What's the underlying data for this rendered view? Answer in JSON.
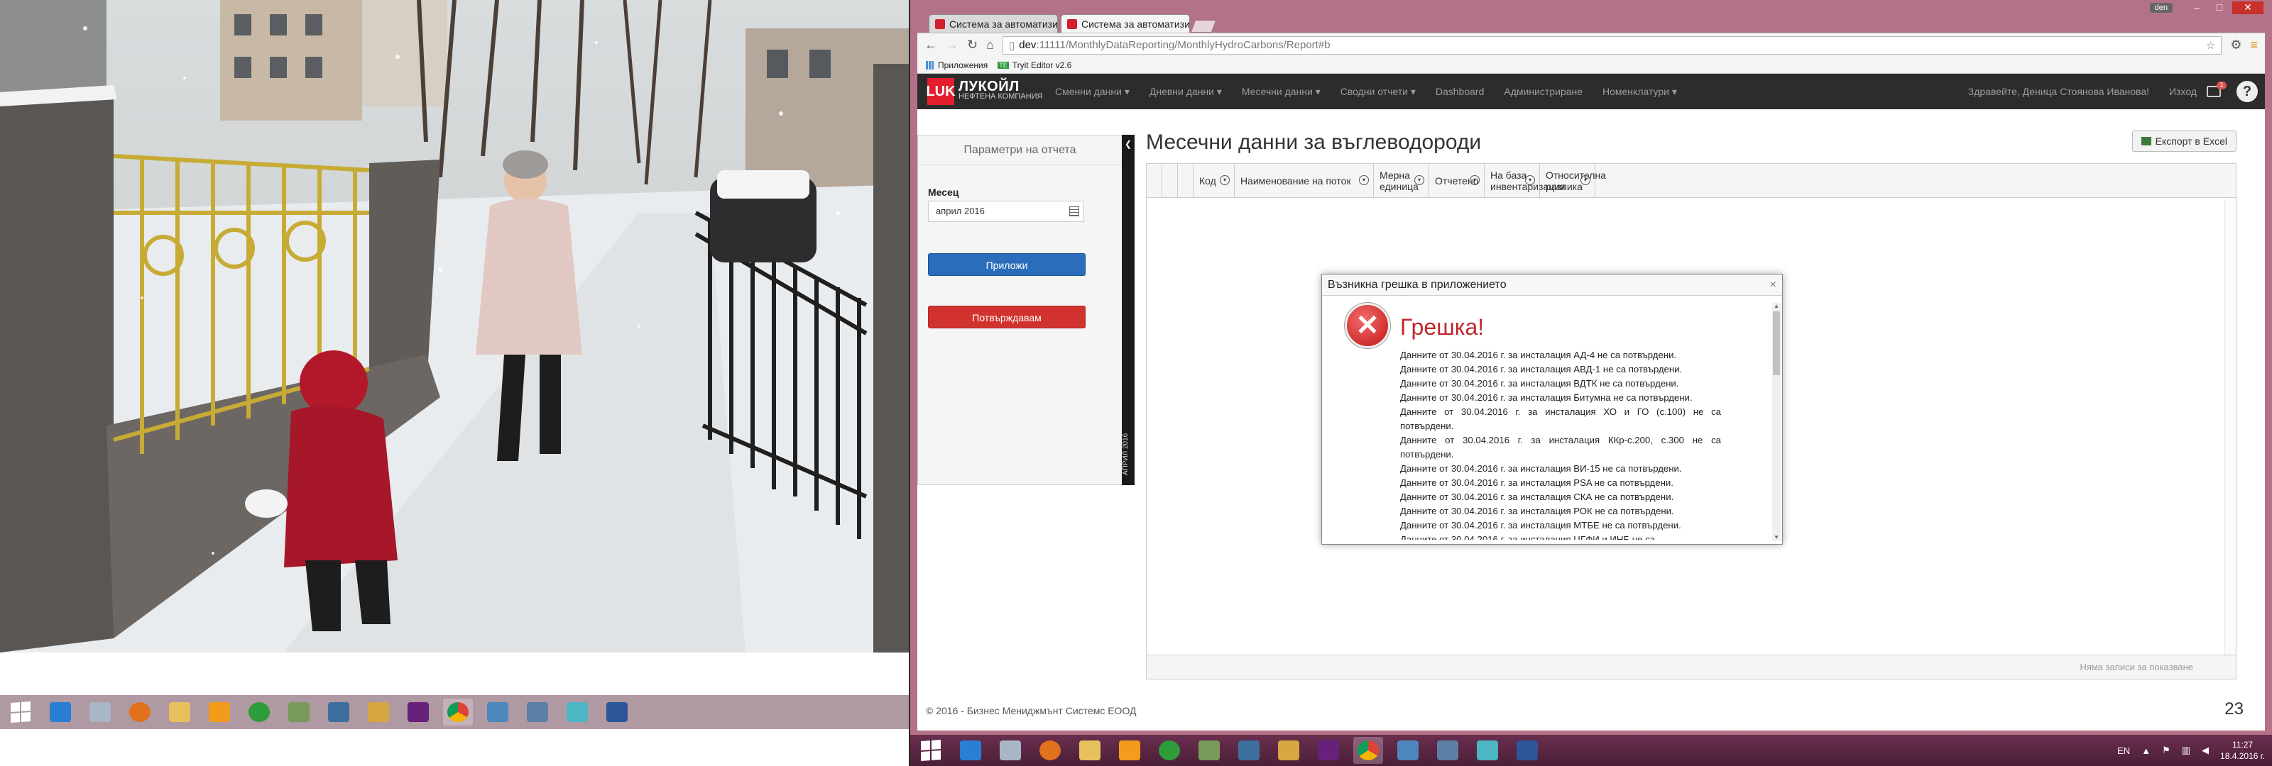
{
  "browser": {
    "user_label": "den",
    "tabs": [
      {
        "title": "Система за автоматизир"
      },
      {
        "title": "Система за автоматизир"
      }
    ],
    "url_host": "dev",
    "url_path": ":11111/MonthlyDataReporting/MonthlyHydroCarbons/Report#b",
    "bookmarks": [
      {
        "label": "Приложения"
      },
      {
        "label": "Tryit Editor v2.6",
        "icon_text": "TE"
      }
    ]
  },
  "app": {
    "brand": {
      "mark": "LUK",
      "name": "ЛУКОЙЛ",
      "tagline": "НЕФТЕНА КОМПАНИЯ"
    },
    "nav": [
      {
        "label": "Сменни данни ▾"
      },
      {
        "label": "Дневни данни ▾"
      },
      {
        "label": "Месечни данни ▾"
      },
      {
        "label": "Сводни отчети ▾"
      },
      {
        "label": "Dashboard"
      },
      {
        "label": "Администриране"
      },
      {
        "label": "Номенклатури ▾"
      }
    ],
    "greeting": "Здравейте, Деница Стоянова Иванова!",
    "logout": "Изход",
    "notification_count": "1",
    "help": "?",
    "params": {
      "title": "Параметри на отчета",
      "month_label": "Месец",
      "month_value": "април 2016",
      "apply_label": "Приложи",
      "confirm_label": "Потвърждавам",
      "rail_arrow": "❮",
      "rail_label": "АПРИЛ 2016"
    },
    "page_title": "Месечни данни за въглеводороди",
    "export_label": "Експорт в Excel",
    "grid": {
      "columns": [
        {
          "label": ""
        },
        {
          "label": ""
        },
        {
          "label": ""
        },
        {
          "label": "Код"
        },
        {
          "label": "Наименование на поток"
        },
        {
          "label": "Мерна единица"
        },
        {
          "label": "Отчетено"
        },
        {
          "label": "На база инвентаризация"
        },
        {
          "label": "Относителна разлика"
        }
      ],
      "empty_text": "Няма записи за показване"
    },
    "footer": "© 2016 - Бизнес Мениджмънт Системс ЕООД",
    "footer_number": "23"
  },
  "modal": {
    "title": "Възникна грешка в приложението",
    "close": "×",
    "heading": "Грешка!",
    "messages": [
      "Данните от 30.04.2016 г. за инсталация АД-4 не са потвърдени.",
      "Данните от 30.04.2016 г. за инсталация АВД-1 не са потвърдени.",
      "Данните от 30.04.2016 г. за инсталация ВДТК не са потвърдени.",
      "Данните от 30.04.2016 г. за инсталация Битумна не са потвърдени.",
      "Данните от 30.04.2016 г. за инсталация ХО и ГО (с.100) не са потвърдени.",
      "Данните от 30.04.2016 г. за инсталация ККр-с.200, с.300 не са потвърдени.",
      "Данните от 30.04.2016 г. за инсталация ВИ-15 не са потвърдени.",
      "Данните от 30.04.2016 г. за инсталация PSA не са потвърдени.",
      "Данните от 30.04.2016 г. за инсталация СКА не са потвърдени.",
      "Данните от 30.04.2016 г. за инсталация РОК не са потвърдени.",
      "Данните от 30.04.2016 г. за инсталация МТБЕ не са потвърдени.",
      "Данните от 30.04.2016 г. за инсталация ЦГФИ и ИНБ не са"
    ]
  },
  "taskbar": {
    "lang": "EN",
    "time": "11:27",
    "date": "18.4.2016 г."
  },
  "colors": {
    "chrome_frame": "#b47289",
    "navbar": "#2c2c2c",
    "brand_red": "#e41f2d",
    "apply_blue": "#2a6ebb",
    "confirm_red": "#d2322d",
    "error_red": "#c0272d"
  }
}
